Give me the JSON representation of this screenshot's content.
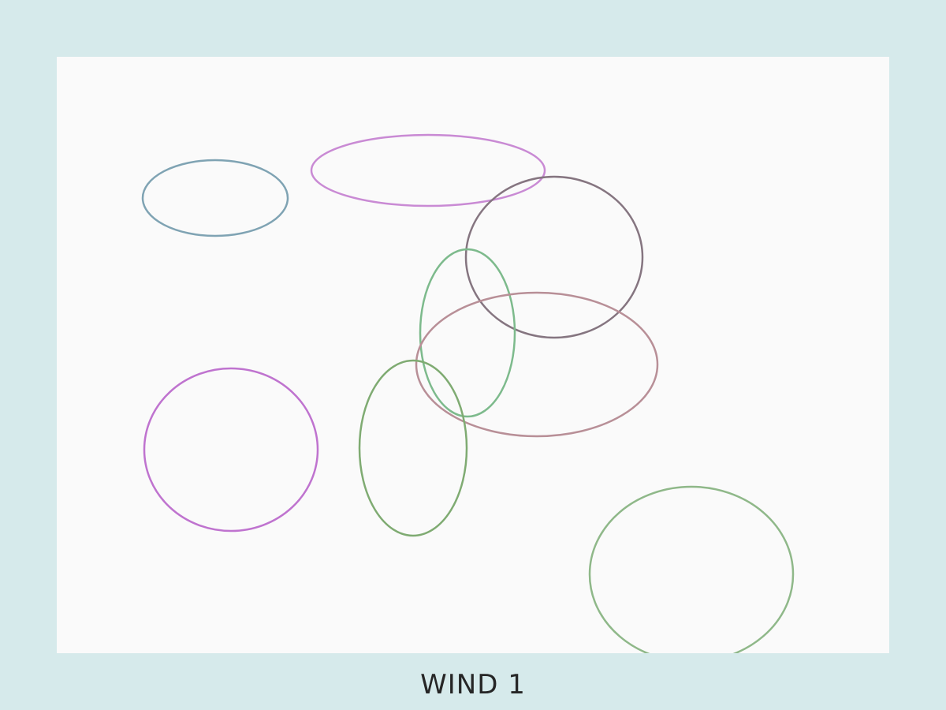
{
  "caption": "WIND 1",
  "ellipses": [
    {
      "name": "ellipse-steel-blue",
      "color": "#7fa3b3"
    },
    {
      "name": "ellipse-lilac",
      "color": "#c98ad4"
    },
    {
      "name": "ellipse-slate-gray",
      "color": "#857580"
    },
    {
      "name": "ellipse-sea-green",
      "color": "#7dba8c"
    },
    {
      "name": "ellipse-dusty-rose",
      "color": "#b88f97"
    },
    {
      "name": "ellipse-orchid",
      "color": "#bf73cf"
    },
    {
      "name": "ellipse-moss-green",
      "color": "#7fab72"
    },
    {
      "name": "ellipse-sage-green",
      "color": "#8fb889"
    }
  ]
}
